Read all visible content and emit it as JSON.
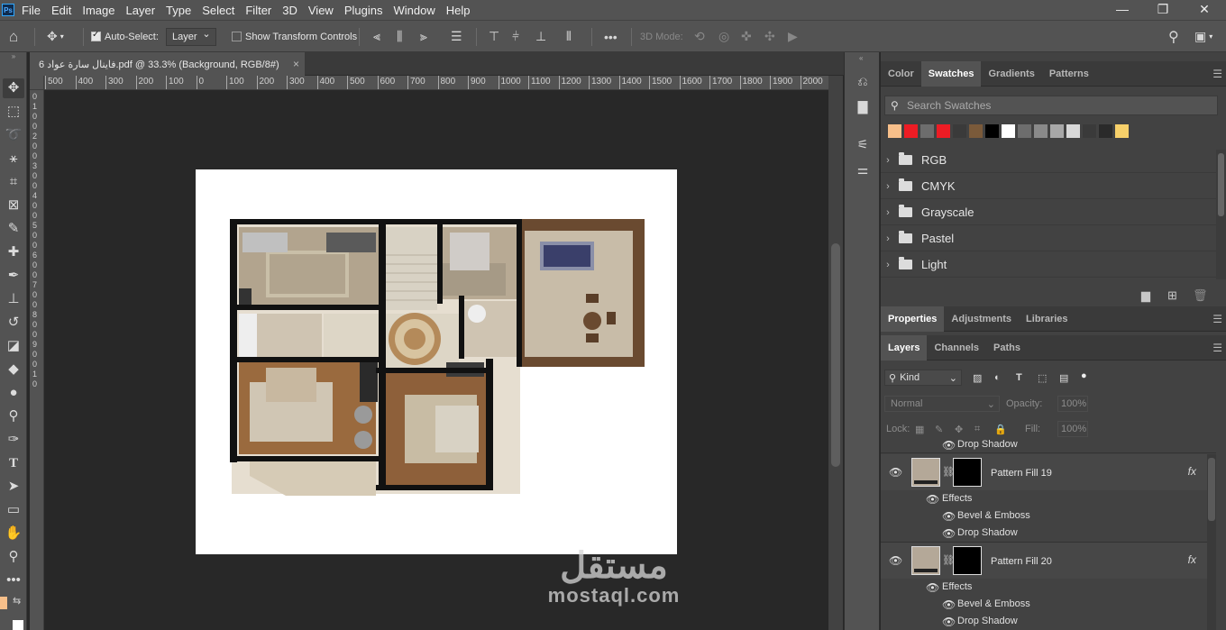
{
  "menu": [
    "File",
    "Edit",
    "Image",
    "Layer",
    "Type",
    "Select",
    "Filter",
    "3D",
    "View",
    "Plugins",
    "Window",
    "Help"
  ],
  "app_logo": "Ps",
  "window_controls": {
    "minimize": "—",
    "maximize": "❐",
    "close": "✕"
  },
  "options": {
    "auto_select_label": "Auto-Select:",
    "auto_select_checked": true,
    "auto_select_target": "Layer",
    "transform_label": "Show Transform Controls",
    "transform_checked": false,
    "more": "•••",
    "mode_3d_label": "3D Mode:"
  },
  "document": {
    "tab_title": "6 فاينال سارة عواد.pdf @ 33.3% (Background, RGB/8#)",
    "close": "×"
  },
  "ruler_top": [
    "500",
    "400",
    "300",
    "200",
    "100",
    "0",
    "100",
    "200",
    "300",
    "400",
    "500",
    "600",
    "700",
    "800",
    "900",
    "1000",
    "1100",
    "1200",
    "1300",
    "1400",
    "1500",
    "1600",
    "1700",
    "1800",
    "1900",
    "2000"
  ],
  "ruler_left": [
    "0",
    "1",
    "0",
    "0",
    "2",
    "0",
    "0",
    "3",
    "0",
    "0",
    "4",
    "0",
    "0",
    "5",
    "0",
    "0",
    "6",
    "0",
    "0",
    "7",
    "0",
    "0",
    "8",
    "0",
    "0",
    "9",
    "0",
    "0",
    "1",
    "0"
  ],
  "watermark": {
    "arabic": "مستقل",
    "latin": "mostaql.com"
  },
  "swatches_panel": {
    "tabs": [
      "Color",
      "Swatches",
      "Gradients",
      "Patterns"
    ],
    "active_tab": "Swatches",
    "search_placeholder": "Search Swatches",
    "recent_colors": [
      "#f7bf8a",
      "#ed1c24",
      "#6d6d6d",
      "#ed1c24",
      "#3a3a3a",
      "#7a5a3a",
      "#000000",
      "#ffffff",
      "#6d6d6d",
      "#8a8a8a",
      "#a8a8a8",
      "#d8d8d8",
      "#3a3a3a",
      "#2a2a2a",
      "#f7d06a"
    ],
    "groups": [
      "RGB",
      "CMYK",
      "Grayscale",
      "Pastel",
      "Light"
    ]
  },
  "properties_tabs": [
    "Properties",
    "Adjustments",
    "Libraries"
  ],
  "layers_panel": {
    "tabs": [
      "Layers",
      "Channels",
      "Paths"
    ],
    "filter_kind": "Kind",
    "blend_mode": "Normal",
    "opacity_label": "Opacity:",
    "opacity_value": "100%",
    "lock_label": "Lock:",
    "fill_label": "Fill:",
    "fill_value": "100%",
    "top_partial_effect": "Drop Shadow",
    "layers": [
      {
        "name": "Pattern Fill 19",
        "effects_label": "Effects",
        "effects": [
          "Bevel & Emboss",
          "Drop Shadow"
        ],
        "fx": "fx"
      },
      {
        "name": "Pattern Fill 20",
        "effects_label": "Effects",
        "effects": [
          "Bevel & Emboss",
          "Drop Shadow"
        ],
        "fx": "fx"
      }
    ]
  },
  "colors": {
    "accent": "#31a8ff",
    "panel": "#424242",
    "chrome": "#535353",
    "canvas_bg": "#282828"
  }
}
